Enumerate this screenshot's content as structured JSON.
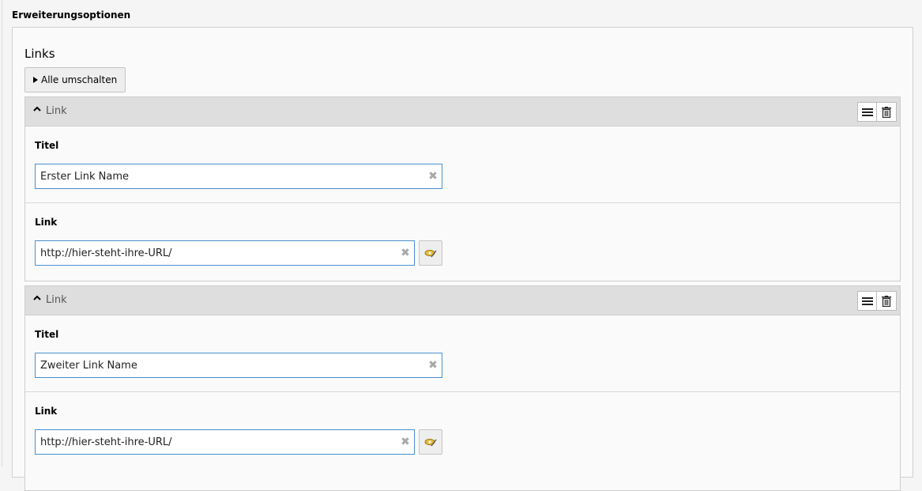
{
  "section": {
    "title": "Erweiterungsoptionen"
  },
  "links": {
    "label": "Links",
    "toggle_label": "Alle umschalten",
    "items": [
      {
        "header": "Link",
        "title_label": "Titel",
        "title_value": "Erster Link Name",
        "link_label": "Link",
        "link_value": "http://hier-steht-ihre-URL/"
      },
      {
        "header": "Link",
        "title_label": "Titel",
        "title_value": "Zweiter Link Name",
        "link_label": "Link",
        "link_value": "http://hier-steht-ihre-URL/"
      }
    ]
  },
  "icons": {
    "toggle": "triangle-right-icon",
    "collapse": "chevron-up-icon",
    "sort": "hamburger-icon",
    "delete": "trash-icon",
    "clear": "clear-x-icon",
    "wizard": "link-wizard-icon"
  }
}
